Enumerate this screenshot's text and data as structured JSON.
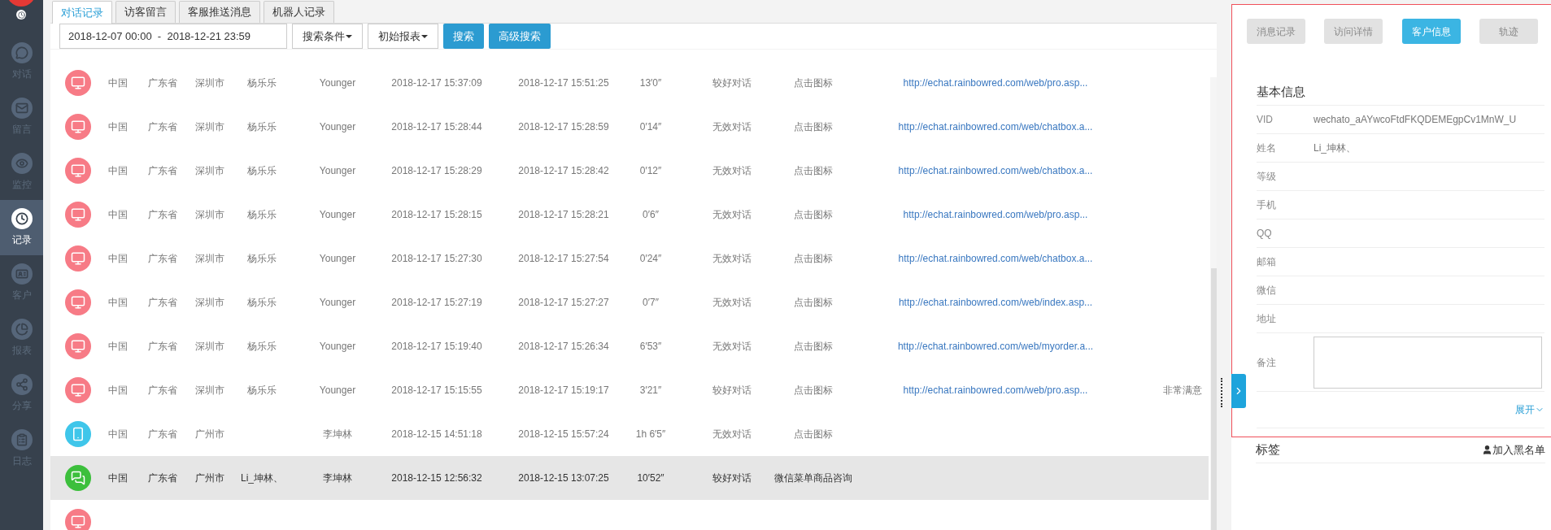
{
  "sidebar": {
    "items": [
      {
        "label": "对话",
        "selected": false
      },
      {
        "label": "留言",
        "selected": false
      },
      {
        "label": "监控",
        "selected": false
      },
      {
        "label": "记录",
        "selected": true
      },
      {
        "label": "客户",
        "selected": false
      },
      {
        "label": "报表",
        "selected": false
      },
      {
        "label": "分享",
        "selected": false
      },
      {
        "label": "日志",
        "selected": false
      }
    ]
  },
  "tabs": [
    {
      "label": "对话记录",
      "selected": true
    },
    {
      "label": "访客留言",
      "selected": false
    },
    {
      "label": "客服推送消息",
      "selected": false
    },
    {
      "label": "机器人记录",
      "selected": false
    }
  ],
  "toolbar": {
    "date_range": "2018-12-07 00:00  -  2018-12-21 23:59",
    "dropdowns": [
      "搜索条件",
      "初始报表"
    ],
    "buttons": [
      "搜索",
      "高级搜索"
    ]
  },
  "table": {
    "rows": [
      {
        "kind": "pc",
        "selected": false,
        "country": "中国",
        "province": "广东省",
        "city": "深圳市",
        "visitor": "杨乐乐",
        "agent": "Younger",
        "start": "2018-12-17 15:37:09",
        "end": "2018-12-17 15:51:25",
        "duration": "13′0″",
        "result": "较好对话",
        "source": "点击图标",
        "url": "http://echat.rainbowred.com/web/pro.asp..."
      },
      {
        "kind": "pc",
        "selected": false,
        "country": "中国",
        "province": "广东省",
        "city": "深圳市",
        "visitor": "杨乐乐",
        "agent": "Younger",
        "start": "2018-12-17 15:28:44",
        "end": "2018-12-17 15:28:59",
        "duration": "0′14″",
        "result": "无效对话",
        "source": "点击图标",
        "url": "http://echat.rainbowred.com/web/chatbox.a..."
      },
      {
        "kind": "pc",
        "selected": false,
        "country": "中国",
        "province": "广东省",
        "city": "深圳市",
        "visitor": "杨乐乐",
        "agent": "Younger",
        "start": "2018-12-17 15:28:29",
        "end": "2018-12-17 15:28:42",
        "duration": "0′12″",
        "result": "无效对话",
        "source": "点击图标",
        "url": "http://echat.rainbowred.com/web/chatbox.a..."
      },
      {
        "kind": "pc",
        "selected": false,
        "country": "中国",
        "province": "广东省",
        "city": "深圳市",
        "visitor": "杨乐乐",
        "agent": "Younger",
        "start": "2018-12-17 15:28:15",
        "end": "2018-12-17 15:28:21",
        "duration": "0′6″",
        "result": "无效对话",
        "source": "点击图标",
        "url": "http://echat.rainbowred.com/web/pro.asp..."
      },
      {
        "kind": "pc",
        "selected": false,
        "country": "中国",
        "province": "广东省",
        "city": "深圳市",
        "visitor": "杨乐乐",
        "agent": "Younger",
        "start": "2018-12-17 15:27:30",
        "end": "2018-12-17 15:27:54",
        "duration": "0′24″",
        "result": "无效对话",
        "source": "点击图标",
        "url": "http://echat.rainbowred.com/web/chatbox.a..."
      },
      {
        "kind": "pc",
        "selected": false,
        "country": "中国",
        "province": "广东省",
        "city": "深圳市",
        "visitor": "杨乐乐",
        "agent": "Younger",
        "start": "2018-12-17 15:27:19",
        "end": "2018-12-17 15:27:27",
        "duration": "0′7″",
        "result": "无效对话",
        "source": "点击图标",
        "url": "http://echat.rainbowred.com/web/index.asp..."
      },
      {
        "kind": "pc",
        "selected": false,
        "country": "中国",
        "province": "广东省",
        "city": "深圳市",
        "visitor": "杨乐乐",
        "agent": "Younger",
        "start": "2018-12-17 15:19:40",
        "end": "2018-12-17 15:26:34",
        "duration": "6′53″",
        "result": "无效对话",
        "source": "点击图标",
        "url": "http://echat.rainbowred.com/web/myorder.a..."
      },
      {
        "kind": "pc",
        "selected": false,
        "country": "中国",
        "province": "广东省",
        "city": "深圳市",
        "visitor": "杨乐乐",
        "agent": "Younger",
        "start": "2018-12-17 15:15:55",
        "end": "2018-12-17 15:19:17",
        "duration": "3′21″",
        "result": "较好对话",
        "source": "点击图标",
        "url": "http://echat.rainbowred.com/web/pro.asp...",
        "satisfaction": "非常满意"
      },
      {
        "kind": "mobile",
        "selected": false,
        "country": "中国",
        "province": "广东省",
        "city": "广州市",
        "agent": "李坤林",
        "start": "2018-12-15 14:51:18",
        "end": "2018-12-15 15:57:24",
        "duration": "1h 6′5″",
        "result": "无效对话",
        "source": "点击图标"
      },
      {
        "kind": "wechat",
        "selected": true,
        "country": "中国",
        "province": "广东省",
        "city": "广州市",
        "visitor": "Li_坤林、",
        "agent": "李坤林",
        "start": "2018-12-15 12:56:32",
        "end": "2018-12-15 13:07:25",
        "duration": "10′52″",
        "result": "较好对话",
        "source": "微信菜单商品咨询"
      },
      {
        "kind": "pc",
        "selected": false
      }
    ]
  },
  "detail": {
    "tabs": [
      {
        "label": "消息记录",
        "selected": false
      },
      {
        "label": "访问详情",
        "selected": false
      },
      {
        "label": "客户信息",
        "selected": true
      },
      {
        "label": "轨迹",
        "selected": false
      }
    ],
    "section_title": "基本信息",
    "fields": [
      {
        "label": "VID",
        "value": "wechato_aAYwcoFtdFKQDEMEgpCv1MnW_U"
      },
      {
        "label": "姓名",
        "value": "Li_坤林、"
      },
      {
        "label": "等级"
      },
      {
        "label": "手机"
      },
      {
        "label": "QQ"
      },
      {
        "label": "邮箱"
      },
      {
        "label": "微信"
      },
      {
        "label": "地址"
      }
    ],
    "remark_label": "备注",
    "expand": "展开",
    "tags_title": "标签",
    "blacklist": "加入黑名单"
  }
}
